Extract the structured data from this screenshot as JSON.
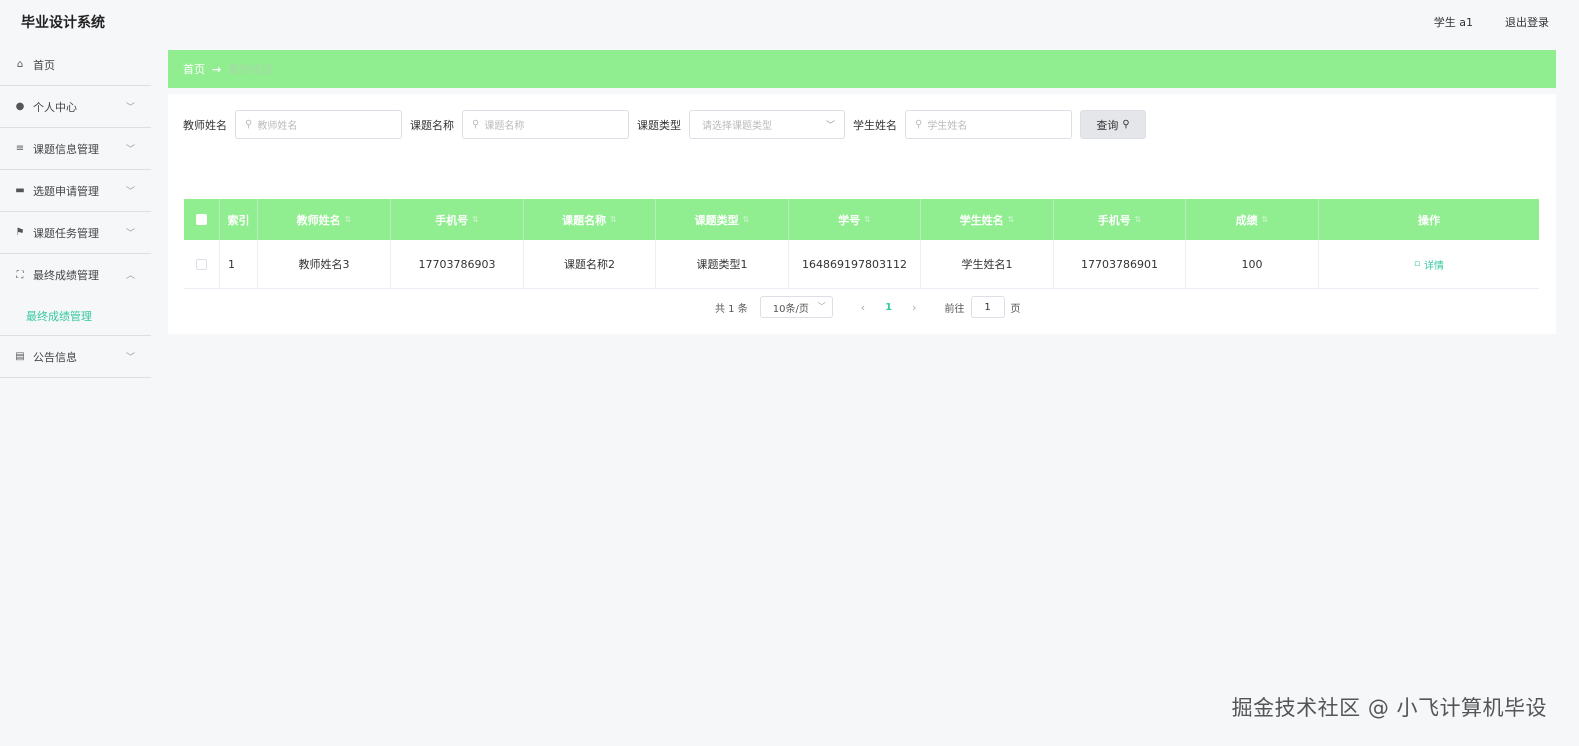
{
  "app": {
    "title": "毕业设计系统"
  },
  "header": {
    "user": "学生 a1",
    "logout": "退出登录"
  },
  "sidebar": {
    "items": [
      {
        "label": "首页",
        "icon": "home-icon",
        "glyph": "⌂",
        "has_chevron": false
      },
      {
        "label": "个人中心",
        "icon": "user-icon",
        "glyph": "●",
        "has_chevron": true
      },
      {
        "label": "课题信息管理",
        "icon": "list-icon",
        "glyph": "≡",
        "has_chevron": true
      },
      {
        "label": "选题申请管理",
        "icon": "message-icon",
        "glyph": "▬",
        "has_chevron": true
      },
      {
        "label": "课题任务管理",
        "icon": "flag-icon",
        "glyph": "⚑",
        "has_chevron": true
      },
      {
        "label": "最终成绩管理",
        "icon": "fullscreen-icon",
        "glyph": "⛶",
        "has_chevron": true,
        "expanded": true
      }
    ],
    "sub_item": "最终成绩管理",
    "last_item": {
      "label": "公告信息",
      "icon": "clipboard-icon",
      "glyph": "▤"
    }
  },
  "breadcrumb": {
    "home": "首页",
    "arrow": "→",
    "current": "最终成绩"
  },
  "search": {
    "teacher_label": "教师姓名",
    "teacher_placeholder": "教师姓名",
    "topic_label": "课题名称",
    "topic_placeholder": "课题名称",
    "type_label": "课题类型",
    "type_placeholder": "请选择课题类型",
    "student_label": "学生姓名",
    "student_placeholder": "学生姓名",
    "query_button": "查询"
  },
  "table": {
    "columns": [
      "索引",
      "教师姓名",
      "手机号",
      "课题名称",
      "课题类型",
      "学号",
      "学生姓名",
      "手机号",
      "成绩",
      "操作"
    ],
    "rows": [
      {
        "index": "1",
        "teacher": "教师姓名3",
        "teacher_phone": "17703786903",
        "topic": "课题名称2",
        "type": "课题类型1",
        "student_no": "164869197803112",
        "student": "学生姓名1",
        "student_phone": "17703786901",
        "score": "100",
        "action": "详情"
      }
    ]
  },
  "pagination": {
    "total": "共 1 条",
    "page_size": "10条/页",
    "current_page": "1",
    "goto_label": "前往",
    "goto_value": "1",
    "page_suffix": "页"
  },
  "watermark": "掘金技术社区 @ 小飞计算机毕设",
  "colors": {
    "accent": "#90ee90",
    "link": "#36c9a0"
  }
}
